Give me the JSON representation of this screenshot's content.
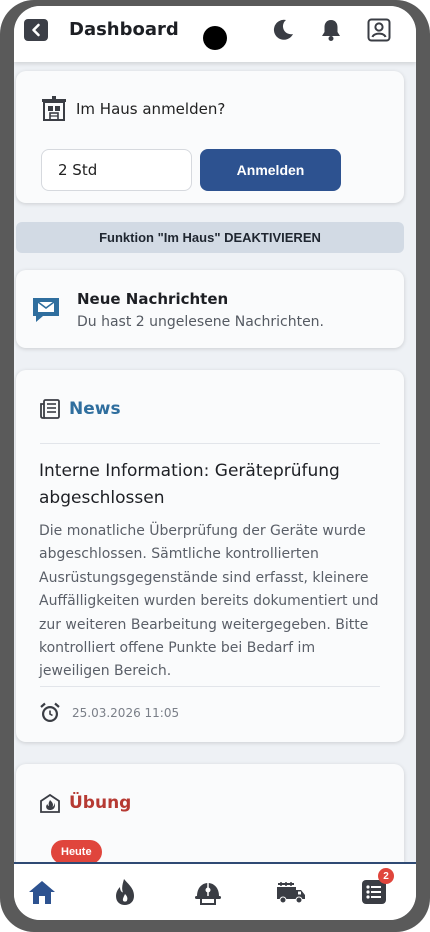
{
  "header": {
    "title": "Dashboard"
  },
  "haus": {
    "prompt": "Im Haus anmelden?",
    "hours_value": "2 Std",
    "login_label": "Anmelden",
    "deactivate_label": "Funktion \"Im Haus\" DEAKTIVIEREN"
  },
  "messages": {
    "title": "Neue Nachrichten",
    "subtitle": "Du hast 2 ungelesene Nachrichten."
  },
  "news": {
    "heading": "News",
    "title": "Interne Information: Geräteprüfung abgeschlossen",
    "body": "Die monatliche Überprüfung der Geräte wurde abgeschlossen. Sämtliche kontrollierten Ausrüstungsgegenstände sind erfasst, kleinere Auffälligkeiten wurden bereits dokumentiert und zur weiteren Bearbeitung weitergegeben. Bitte kontrolliert offene Punkte bei Bedarf im jeweiligen Bereich.",
    "date": "25.03.2026 11:05"
  },
  "uebung": {
    "heading": "Übung",
    "badge": "Heute"
  },
  "bottom_nav": {
    "items": [
      "home-icon",
      "fire-icon",
      "firefighter-helmet-icon",
      "fire-truck-icon",
      "list-icon"
    ],
    "list_badge": "2"
  },
  "colors": {
    "primary": "#2d5290",
    "news": "#2f6e9e",
    "uebung": "#b63a33",
    "badge": "#e0453c"
  }
}
